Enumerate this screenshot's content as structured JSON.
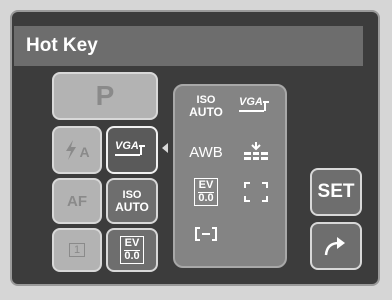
{
  "window": {
    "title": "Hot Key"
  },
  "left_grid": {
    "mode": {
      "label": "P"
    },
    "flash": {
      "label": "A"
    },
    "image_size": {
      "label": "VGA"
    },
    "af": {
      "label": "AF"
    },
    "iso": {
      "line1": "ISO",
      "line2": "AUTO"
    },
    "frame_count": {
      "label": "1"
    },
    "ev": {
      "line1": "EV",
      "line2": "0.0"
    }
  },
  "options_panel": {
    "iso": {
      "line1": "ISO",
      "line2": "AUTO"
    },
    "image_size": {
      "label": "VGA"
    },
    "white_balance": {
      "label": "AWB"
    },
    "ev": {
      "line1": "EV",
      "line2": "0.0"
    }
  },
  "right_buttons": {
    "set": {
      "label": "SET"
    }
  },
  "icons": [
    "flash-auto-icon",
    "vga-resolution-icon",
    "iso-auto-icon",
    "frame-count-icon",
    "ev-icon",
    "white-balance-icon",
    "focus-frame-icon",
    "metering-icon",
    "exit-arrow-icon"
  ]
}
